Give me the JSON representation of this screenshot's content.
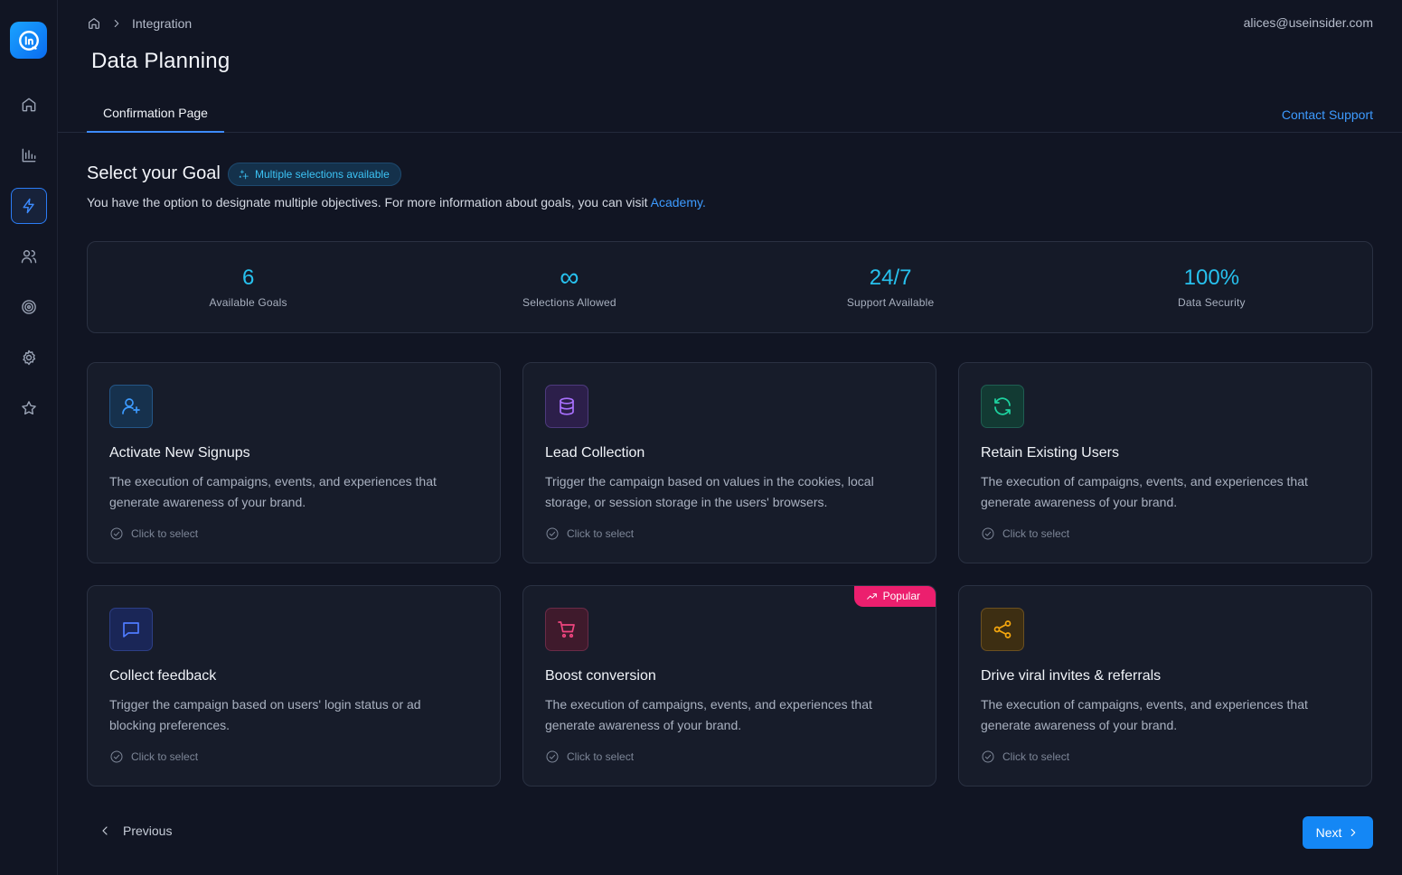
{
  "header": {
    "breadcrumb": "Integration",
    "user_email": "alices@useinsider.com",
    "page_title": "Data Planning",
    "tab": "Confirmation Page",
    "contact_support": "Contact Support"
  },
  "goal": {
    "title": "Select your Goal",
    "badge": "Multiple selections available",
    "description": "You have the option to designate multiple objectives. For more information about goals, you can visit",
    "academy_link": "Academy."
  },
  "stats": [
    {
      "value": "6",
      "label": "Available Goals"
    },
    {
      "value": "∞",
      "label": "Selections Allowed"
    },
    {
      "value": "24/7",
      "label": "Support Available"
    },
    {
      "value": "100%",
      "label": "Data Security"
    }
  ],
  "cards": [
    {
      "title": "Activate New Signups",
      "description": "The execution of campaigns, events, and experiences that generate awareness of your brand.",
      "select": "Click to select",
      "icon": "user-plus-icon",
      "color": "#3d9bff"
    },
    {
      "title": "Lead Collection",
      "description": "Trigger the campaign based on values in the cookies, local storage, or session storage in the users' browsers.",
      "select": "Click to select",
      "icon": "database-icon",
      "color": "#a970ff"
    },
    {
      "title": "Retain Existing Users",
      "description": "The execution of campaigns, events, and experiences that generate awareness of your brand.",
      "select": "Click to select",
      "icon": "refresh-icon",
      "color": "#1ed3a0"
    },
    {
      "title": "Collect feedback",
      "description": "Trigger the campaign based on users' login status or ad blocking preferences.",
      "select": "Click to select",
      "icon": "message-icon",
      "color": "#4f7bff"
    },
    {
      "title": "Boost conversion",
      "description": "The execution of campaigns, events, and experiences that generate awareness of your brand.",
      "select": "Click to select",
      "icon": "cart-icon",
      "color": "#f0457f",
      "badge": "Popular"
    },
    {
      "title": "Drive viral invites & referrals",
      "description": "The execution of campaigns, events, and experiences that generate awareness of your brand.",
      "select": "Click to select",
      "icon": "share-icon",
      "color": "#f5a70e"
    }
  ],
  "footer": {
    "previous": "Previous",
    "next": "Next"
  },
  "colors": {
    "accent": "#1487f5",
    "stat": "#27c1ee",
    "popular": "#ec1f6e",
    "background": "#111523"
  }
}
